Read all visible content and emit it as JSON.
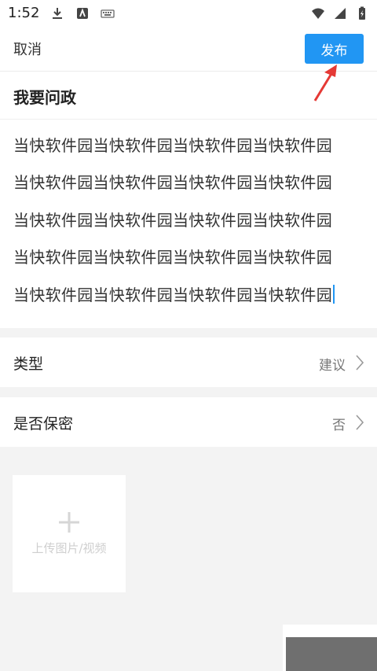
{
  "status_bar": {
    "time": "1:52",
    "icons": [
      "download-icon",
      "app-icon",
      "keyboard-icon",
      "wifi-icon",
      "signal-icon",
      "battery-icon"
    ]
  },
  "header": {
    "cancel_label": "取消",
    "publish_label": "发布",
    "accent_color": "#2196F3"
  },
  "title": {
    "text": "我要问政"
  },
  "content": {
    "lines": [
      "当快软件园当快软件园当快软件园当快软件园",
      "当快软件园当快软件园当快软件园当快软件园",
      "当快软件园当快软件园当快软件园当快软件园",
      "当快软件园当快软件园当快软件园当快软件园",
      "当快软件园当快软件园当快软件园当快软件园"
    ]
  },
  "options": [
    {
      "label": "类型",
      "value": "建议"
    },
    {
      "label": "是否保密",
      "value": "否"
    }
  ],
  "upload": {
    "label": "上传图片/视频"
  },
  "annotation": {
    "arrow_color": "#e53935"
  }
}
